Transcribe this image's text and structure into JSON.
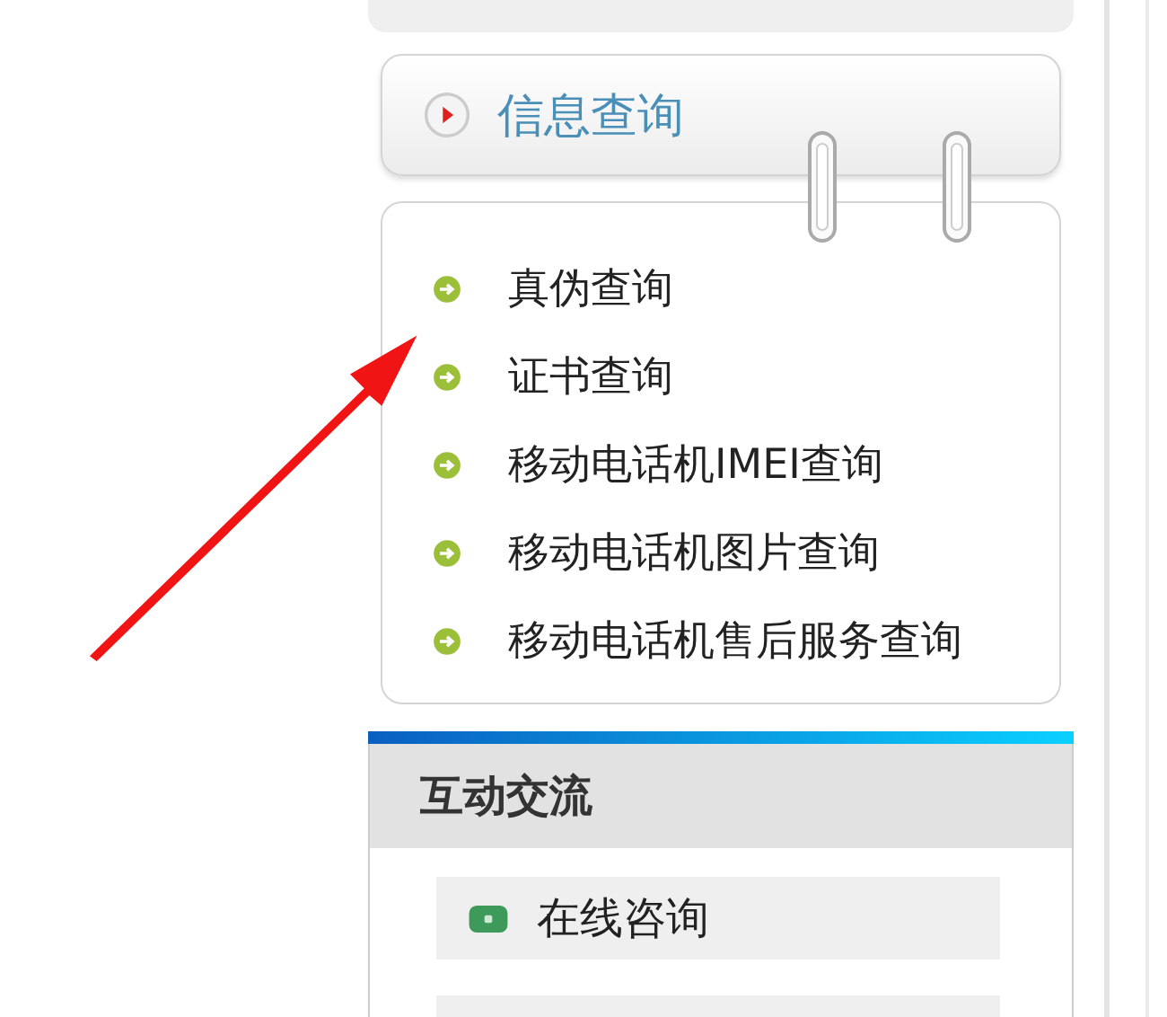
{
  "info_panel": {
    "title": "信息查询",
    "links": [
      {
        "label": "真伪查询"
      },
      {
        "label": "证书查询"
      },
      {
        "label": "移动电话机IMEI查询"
      },
      {
        "label": "移动电话机图片查询"
      },
      {
        "label": "移动电话机售后服务查询"
      }
    ]
  },
  "interaction_panel": {
    "title": "互动交流",
    "items": [
      {
        "label": "在线咨询"
      }
    ]
  }
}
